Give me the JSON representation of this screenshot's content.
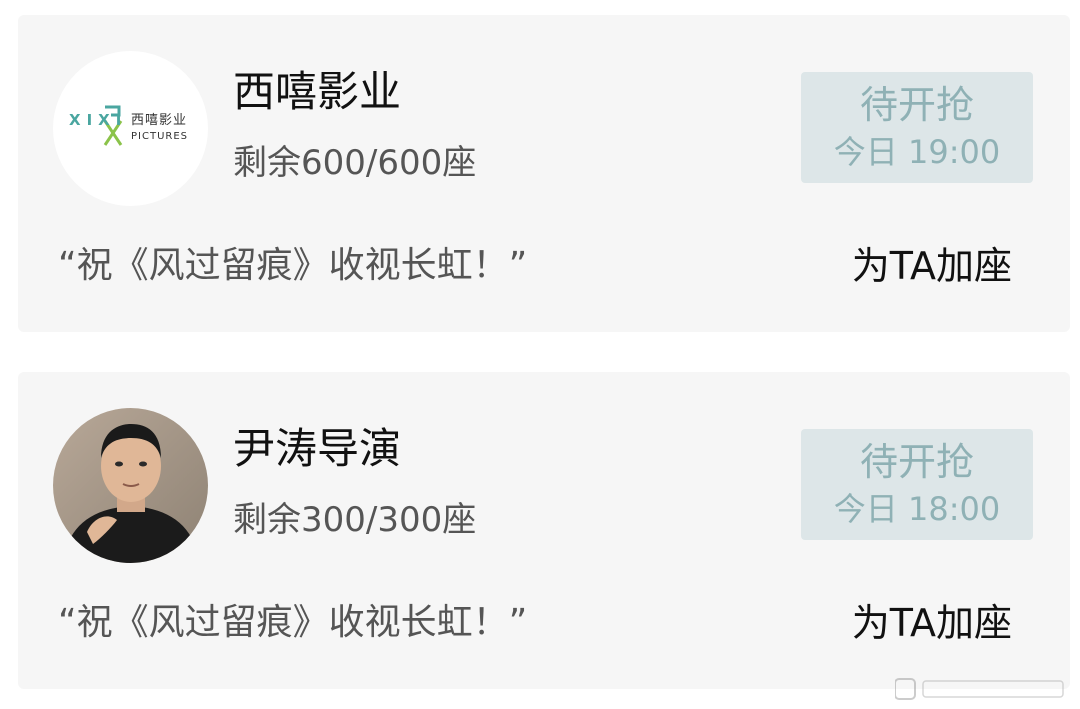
{
  "cards": [
    {
      "name": "西嘻影业",
      "seats": "剩余600/600座",
      "status_title": "待开抢",
      "status_time": "今日 19:00",
      "message": "“祝《风过留痕》收视长虹！”",
      "action": "为TA加座",
      "logo": {
        "xixi": "XIXI",
        "cn": "西嘻影业",
        "en": "PICTURES"
      }
    },
    {
      "name": "尹涛导演",
      "seats": "剩余300/300座",
      "status_title": "待开抢",
      "status_time": "今日 18:00",
      "message": "“祝《风过留痕》收视长虹！”",
      "action": "为TA加座"
    }
  ],
  "colors": {
    "card_bg": "#f6f6f6",
    "status_bg": "#dde6e8",
    "status_text": "#8fb1b5",
    "logo_accent": "#4aa6a0"
  }
}
